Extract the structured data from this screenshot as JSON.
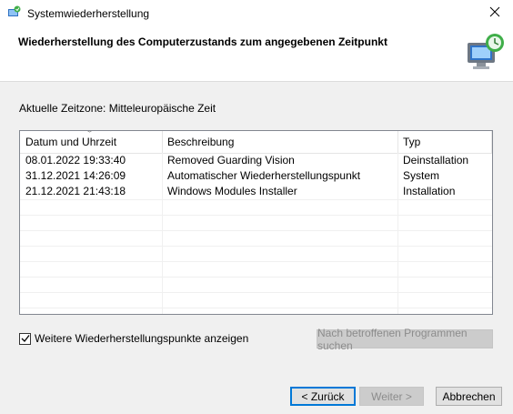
{
  "window": {
    "title": "Systemwiederherstellung",
    "header_title": "Wiederherstellung des Computerzustands zum angegebenen Zeitpunkt"
  },
  "timezone_label": "Aktuelle Zeitzone: Mitteleuropäische Zeit",
  "table": {
    "columns": [
      "Datum und Uhrzeit",
      "Beschreibung",
      "Typ"
    ],
    "sorted_column": "Datum und Uhrzeit",
    "rows": [
      {
        "date": "08.01.2022 19:33:40",
        "description": "Removed Guarding Vision",
        "type": "Deinstallation"
      },
      {
        "date": "31.12.2021 14:26:09",
        "description": "Automatischer Wiederherstellungspunkt",
        "type": "System"
      },
      {
        "date": "21.12.2021 21:43:18",
        "description": "Windows Modules Installer",
        "type": "Installation"
      }
    ]
  },
  "show_more": {
    "label": "Weitere Wiederherstellungspunkte anzeigen",
    "checked": true
  },
  "buttons": {
    "scan": "Nach betroffenen Programmen suchen",
    "back": "< Zurück",
    "next": "Weiter >",
    "cancel": "Abbrechen"
  },
  "icons": {
    "app": "system-restore-icon",
    "header": "computer-restore-icon",
    "close": "close-icon"
  },
  "colors": {
    "accent": "#0078d7",
    "disabled_text": "#8c8c8c"
  }
}
